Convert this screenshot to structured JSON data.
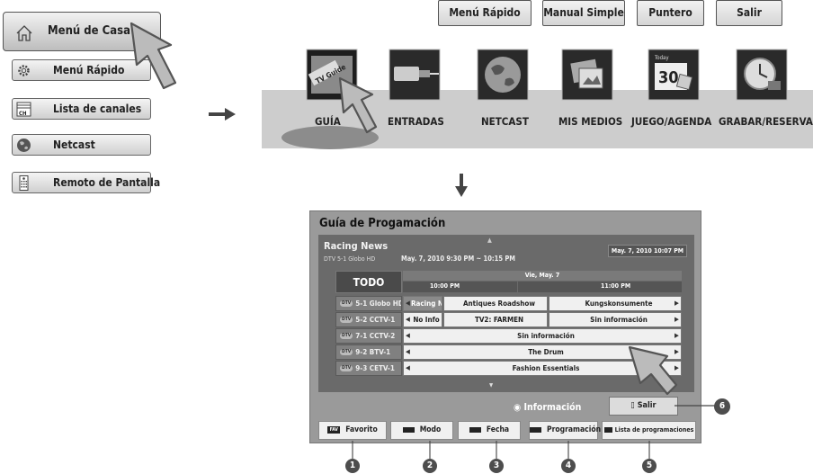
{
  "home_menu": {
    "home_label": "Menú de Casa",
    "items": [
      {
        "label": "Menú Rápido",
        "icon": "gear-icon"
      },
      {
        "label": "Lista de canales",
        "icon": "channel-list-icon"
      },
      {
        "label": "Netcast",
        "icon": "globe-icon"
      },
      {
        "label": "Remoto de Pantalla",
        "icon": "remote-icon"
      }
    ]
  },
  "quick_buttons": [
    "Menú Rápido",
    "Manual Simple",
    "Puntero",
    "Salir"
  ],
  "main_menu": [
    "GUÍA",
    "ENTRADAS",
    "NETCAST",
    "MIS MEDIOS",
    "JUEGO/AGENDA",
    "GRABAR/RESERVAR"
  ],
  "guide_tile_text": "TV Guide",
  "calendar_tile_text": "30",
  "calendar_tile_top": "Today",
  "guide": {
    "title": "Guía de Progamación",
    "program_title": "Racing News",
    "program_channel": "DTV 5-1  Globo HD",
    "program_time": "May. 7, 2010  9:30 PM ~ 10:15 PM",
    "current_datetime": "May. 7, 2010  10:07 PM",
    "todo": "TODO",
    "date_header": "Vie, May. 7",
    "times": [
      "10:00 PM",
      "11:00 PM"
    ],
    "rows": [
      {
        "channel": "5-1 Globo HD",
        "programs": [
          "Racing News",
          "Antiques Roadshow",
          "Kungskonsumente"
        ]
      },
      {
        "channel": "5-2 CCTV-1",
        "programs": [
          "No Info",
          "TV2: FARMEN",
          "Sin información"
        ]
      },
      {
        "channel": "7-1 CCTV-2",
        "programs": [
          "Sin información"
        ]
      },
      {
        "channel": "9-2 BTV-1",
        "programs": [
          "The Drum"
        ]
      },
      {
        "channel": "9-3 CETV-1",
        "programs": [
          "Fashion Essentials"
        ]
      }
    ],
    "dtv_badge": "DTV",
    "info_label": "Información",
    "exit_label": "Salir",
    "function_buttons": [
      {
        "label": "Favorito",
        "swatch": "FAV"
      },
      {
        "label": "Modo"
      },
      {
        "label": "Fecha"
      },
      {
        "label": "Programación"
      },
      {
        "label": "Lista de programaciones"
      }
    ],
    "callouts": [
      "1",
      "2",
      "3",
      "4",
      "5",
      "6"
    ]
  }
}
